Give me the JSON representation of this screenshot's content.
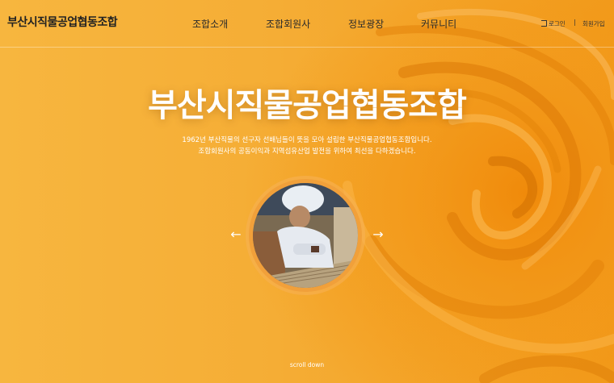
{
  "header": {
    "logo": "부산시직물공업협동조합",
    "nav": [
      "조합소개",
      "조합회원사",
      "정보광장",
      "커뮤니티"
    ],
    "login": "로그인",
    "separator": "|",
    "signup": "회원가입"
  },
  "hero": {
    "title": "부산시직물공업협동조합",
    "desc_line1": "1962년 부산직물의 선구자 선배님들이 뜻을 모아 설립한 부산직물공업협동조합입니다.",
    "desc_line2": "조합회원사의 공동이익과 지역섬유산업 발전을 위하여 최선을 다하겠습니다.",
    "prev_icon": "arrow-left-icon",
    "next_icon": "arrow-right-icon",
    "prev_glyph": "←",
    "next_glyph": "→",
    "scroll": "scroll down"
  },
  "colors": {
    "background": "#f4a92e",
    "fabric": "#f29318",
    "text_light": "#ffffff",
    "text_dark": "#222222"
  }
}
